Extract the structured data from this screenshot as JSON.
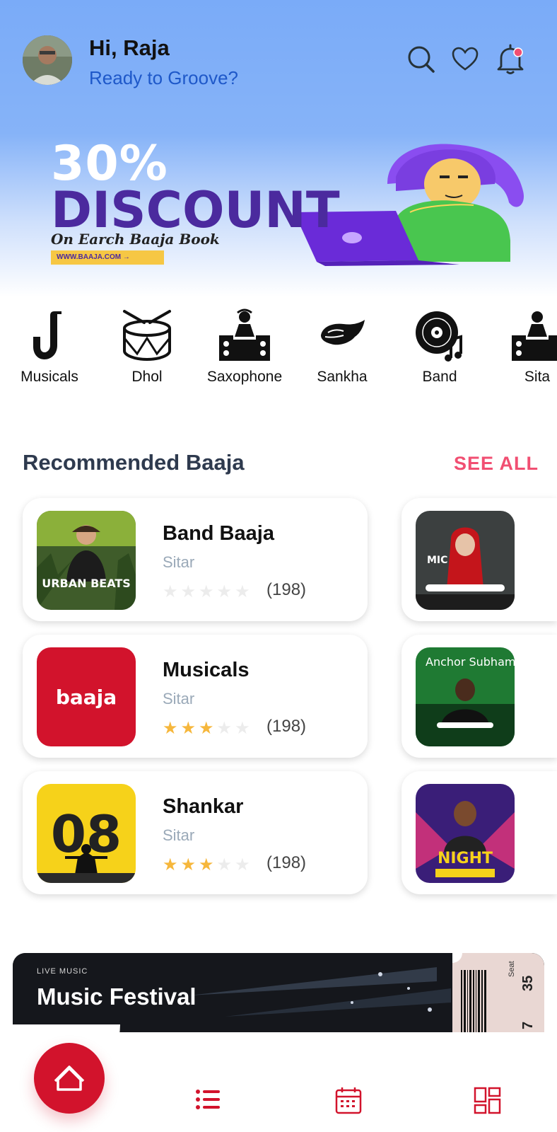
{
  "header": {
    "greeting": "Hi, Raja",
    "subtitle": "Ready to Groove?",
    "icons": [
      "search-icon",
      "heart-icon",
      "bell-icon"
    ],
    "notification_dot_color": "#f14f72"
  },
  "banner": {
    "percent": "30%",
    "headline": "DISCOUNT",
    "tagline": "On Earch Baaja Book",
    "url": "WWW.BAAJA.COM →"
  },
  "categories": [
    {
      "label": "Musicals",
      "icon": "saxophone-icon"
    },
    {
      "label": "Dhol",
      "icon": "drum-icon"
    },
    {
      "label": "Saxophone",
      "icon": "dj-icon"
    },
    {
      "label": "Sankha",
      "icon": "conch-icon"
    },
    {
      "label": "Band",
      "icon": "vinyl-icon"
    },
    {
      "label": "Sita",
      "icon": "dj-icon"
    }
  ],
  "recommended": {
    "title": "Recommended Baaja",
    "see_all": "SEE ALL",
    "items": [
      {
        "name": "Band Baaja",
        "type": "Sitar",
        "rating": 0,
        "count": "(198)",
        "thumb_text": "URBAN BEATS"
      },
      {
        "name": "Musicals",
        "type": "Sitar",
        "rating": 3,
        "count": "(198)",
        "thumb_text": "baaja"
      },
      {
        "name": "Shankar",
        "type": "Sitar",
        "rating": 3,
        "count": "(198)",
        "thumb_text": "08"
      }
    ],
    "side_items": [
      {
        "thumb_text": "MIC"
      },
      {
        "thumb_text": "Anchor Subham"
      },
      {
        "thumb_text": "NIGHT"
      }
    ]
  },
  "promo": {
    "label": "LIVE MUSIC",
    "title": "Music Festival",
    "seat_label": "Seat",
    "seat": "35",
    "row": "7"
  },
  "nav": {
    "items": [
      "home-icon",
      "list-icon",
      "calendar-icon",
      "grid-icon"
    ],
    "accent": "#d2132c"
  }
}
